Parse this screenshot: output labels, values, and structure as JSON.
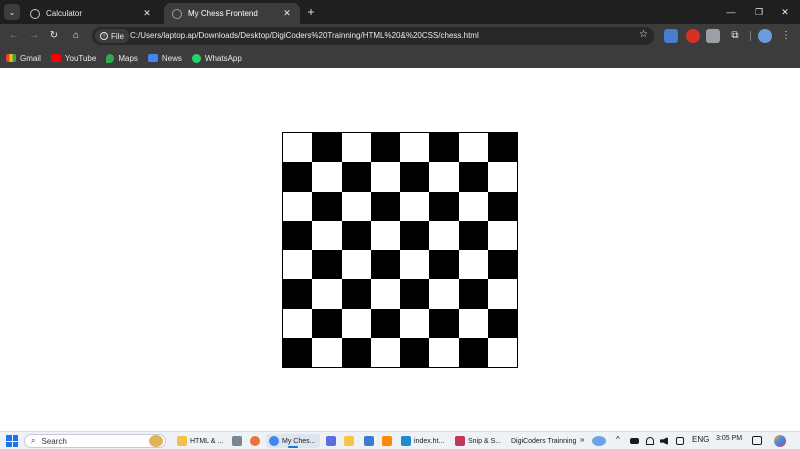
{
  "browser": {
    "tabs": [
      {
        "title": "Calculator",
        "active": false
      },
      {
        "title": "My Chess Frontend",
        "active": true
      }
    ],
    "tab_close_glyph": "✕",
    "new_tab_glyph": "+",
    "window_controls": {
      "minimize": "—",
      "restore": "❐",
      "close": "✕"
    },
    "toolbar": {
      "back": "←",
      "forward": "→",
      "reload": "↻",
      "home": "⌂",
      "site_chip": "File",
      "url": "C:/Users/laptop.ap/Downloads/Desktop/DigiCoders%20Trainning/HTML%20&%20CSS/chess.html",
      "star": "☆",
      "extensions_glyph": "⧉",
      "menu": "⋮"
    },
    "bookmarks": [
      {
        "label": "Gmail",
        "icon": "gmail-icon"
      },
      {
        "label": "YouTube",
        "icon": "youtube-icon"
      },
      {
        "label": "Maps",
        "icon": "maps-icon"
      },
      {
        "label": "News",
        "icon": "news-icon"
      },
      {
        "label": "WhatsApp",
        "icon": "whatsapp-icon"
      }
    ]
  },
  "chessboard": {
    "rows": 8,
    "cols": 8,
    "top_left_color": "white",
    "light_color": "#ffffff",
    "dark_color": "#000000"
  },
  "taskbar": {
    "search_label": "Search",
    "search_glyph": "⌕",
    "items": [
      {
        "label": "HTML & ...",
        "icon": "folder-icon",
        "color": "#f0c24a",
        "active": false
      },
      {
        "label": "My Ches...",
        "icon": "chrome-icon",
        "color": "#4285f4",
        "active": true
      },
      {
        "label": "index.ht...",
        "icon": "vscode-icon",
        "color": "#1f8ad2",
        "active": false
      },
      {
        "label": "Snip & S...",
        "icon": "snipping-tool-icon",
        "color": "#c5375a",
        "active": false
      },
      {
        "label": "DigiCoders Trainning",
        "icon": "",
        "color": "",
        "active": false
      }
    ],
    "overflow": "»",
    "tray": {
      "chevron": "^",
      "language": "ENG",
      "time": "3:05 PM"
    }
  }
}
